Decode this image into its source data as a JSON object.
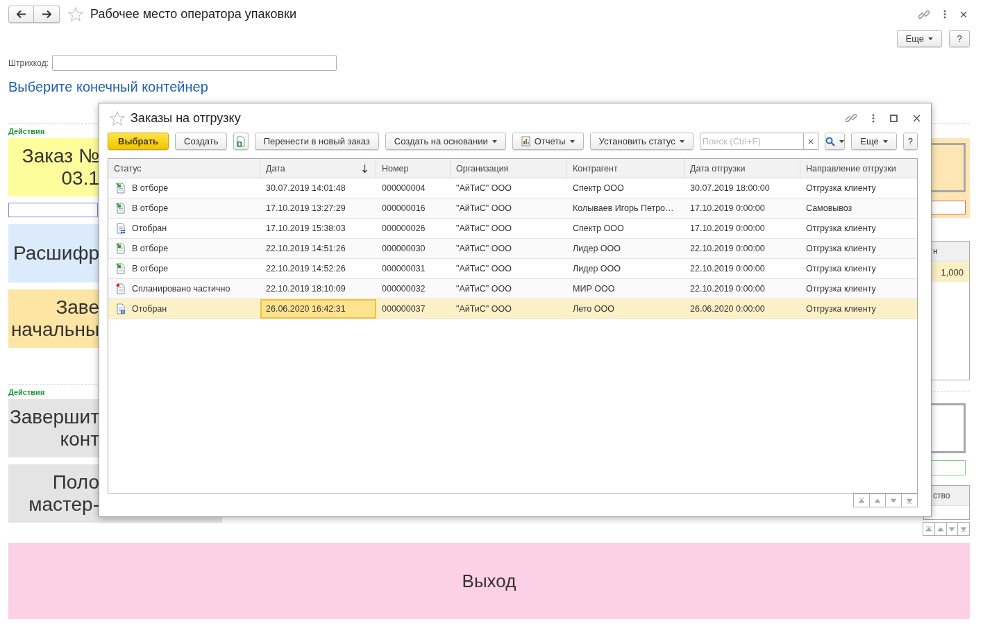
{
  "window": {
    "title": "Рабочее место оператора упаковки"
  },
  "commands": [
    {
      "kind": "menu",
      "label": "Еще"
    },
    {
      "kind": "button",
      "label": "?"
    }
  ],
  "barcode": {
    "label": "Штрихкод:"
  },
  "heading": "Выберите конечный контейнер",
  "left_sections": [
    {
      "label": "Действия",
      "tiles": [
        {
          "kind": "order",
          "lines": [
            "Заказ №",
            "03.1"
          ]
        },
        {
          "kind": "field"
        },
        {
          "kind": "decode",
          "lines": [
            "Расшифр"
          ]
        },
        {
          "kind": "start",
          "lines": [
            "Заве",
            "начальны"
          ]
        }
      ]
    },
    {
      "label": "Действия",
      "tiles": [
        {
          "kind": "finish",
          "lines": [
            "Завершит",
            "конт"
          ]
        },
        {
          "kind": "master",
          "lines": [
            "Поло",
            "мастер-"
          ]
        }
      ]
    }
  ],
  "right_panel": {
    "quantity_table": {
      "column": "н",
      "value": "1,000"
    },
    "items_table": {
      "column": "ство"
    }
  },
  "exit_button": "Выход",
  "dialog": {
    "title": "Заказы на отгрузку",
    "toolbar": [
      {
        "kind": "primary",
        "label": "Выбрать"
      },
      {
        "kind": "button",
        "label": "Создать"
      },
      {
        "kind": "icon"
      },
      {
        "kind": "button",
        "label": "Перенести в новый заказ"
      },
      {
        "kind": "menu",
        "label": "Создать на основании"
      },
      {
        "kind": "report_menu",
        "label": "Отчеты"
      },
      {
        "kind": "menu",
        "label": "Установить статус"
      },
      {
        "kind": "search",
        "placeholder": "Поиск (Ctrl+F)"
      },
      {
        "kind": "search_menu"
      },
      {
        "kind": "menu",
        "label": "Еще"
      },
      {
        "kind": "button",
        "label": "?"
      }
    ],
    "table": {
      "columns": [
        {
          "label": "Статус",
          "sorted_desc": false,
          "current": false
        },
        {
          "label": "Дата",
          "sorted_desc": true,
          "current": true
        },
        {
          "label": "Номер",
          "sorted_desc": false,
          "current": false
        },
        {
          "label": "Организация",
          "sorted_desc": false,
          "current": false
        },
        {
          "label": "Контрагент",
          "sorted_desc": false,
          "current": false
        },
        {
          "label": "Дата отгрузки",
          "sorted_desc": false,
          "current": false
        },
        {
          "label": "Направление отгрузки",
          "sorted_desc": false,
          "current": false
        }
      ],
      "rows": [
        {
          "kind": "picking",
          "cells": [
            "В отборе",
            "30.07.2019 14:01:48",
            "000000004",
            "\"АйТиС\" ООО",
            "Спектр ООО",
            "30.07.2019 18:00:00",
            "Отгрузка клиенту"
          ],
          "selected": false
        },
        {
          "kind": "picking",
          "cells": [
            "В отборе",
            "17.10.2019 13:27:29",
            "000000016",
            "\"АйТиС\" ООО",
            "Колываев Игорь Петро…",
            "17.10.2019 0:00:00",
            "Самовывоз"
          ],
          "selected": false
        },
        {
          "kind": "picked",
          "cells": [
            "Отобран",
            "17.10.2019 15:38:03",
            "000000026",
            "\"АйТиС\" ООО",
            "Спектр ООО",
            "17.10.2019 0:00:00",
            "Отгрузка клиенту"
          ],
          "selected": false
        },
        {
          "kind": "picking",
          "cells": [
            "В отборе",
            "22.10.2019 14:51:26",
            "000000030",
            "\"АйТиС\" ООО",
            "Лидер ООО",
            "22.10.2019 0:00:00",
            "Отгрузка клиенту"
          ],
          "selected": false
        },
        {
          "kind": "picking",
          "cells": [
            "В отборе",
            "22.10.2019 14:52:26",
            "000000031",
            "\"АйТиС\" ООО",
            "Лидер ООО",
            "22.10.2019 0:00:00",
            "Отгрузка клиенту"
          ],
          "selected": false
        },
        {
          "kind": "planned",
          "cells": [
            "Спланировано частично",
            "22.10.2019 18:10:09",
            "000000032",
            "\"АйТиС\" ООО",
            "МИР ООО",
            "22.10.2019 0:00:00",
            "Отгрузка клиенту"
          ],
          "selected": false
        },
        {
          "kind": "picked",
          "cells": [
            "Отобран",
            "26.06.2020 16:42:31",
            "000000037",
            "\"АйТиС\" ООО",
            "Лето ООО",
            "26.06.2020 0:00:00",
            "Отгрузка клиенту"
          ],
          "selected": true
        }
      ]
    }
  }
}
